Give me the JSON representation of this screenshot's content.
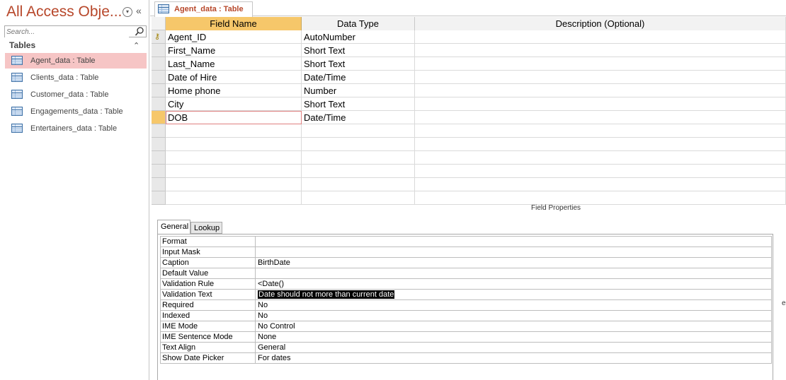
{
  "nav": {
    "title": "All Access Obje...",
    "search_placeholder": "Search...",
    "group_label": "Tables",
    "items": [
      {
        "label": "Agent_data : Table"
      },
      {
        "label": "Clients_data : Table"
      },
      {
        "label": "Customer_data : Table"
      },
      {
        "label": "Engagements_data : Table"
      },
      {
        "label": "Entertainers_data : Table"
      }
    ]
  },
  "tab": {
    "label": "Agent_data : Table"
  },
  "grid": {
    "headers": {
      "field_name": "Field Name",
      "data_type": "Data Type",
      "description": "Description (Optional)"
    },
    "rows": [
      {
        "field": "Agent_ID",
        "type": "AutoNumber",
        "primary_key": true
      },
      {
        "field": "First_Name",
        "type": "Short Text"
      },
      {
        "field": "Last_Name",
        "type": "Short Text"
      },
      {
        "field": "Date of Hire",
        "type": "Date/Time"
      },
      {
        "field": "Home phone",
        "type": "Number"
      },
      {
        "field": "City",
        "type": "Short Text"
      },
      {
        "field": "DOB",
        "type": "Date/Time",
        "current": true
      }
    ]
  },
  "field_properties": {
    "label": "Field Properties",
    "tabs": {
      "general": "General",
      "lookup": "Lookup"
    },
    "props": [
      {
        "name": "Format",
        "value": ""
      },
      {
        "name": "Input Mask",
        "value": ""
      },
      {
        "name": "Caption",
        "value": "BirthDate"
      },
      {
        "name": "Default Value",
        "value": ""
      },
      {
        "name": "Validation Rule",
        "value": "<Date()"
      },
      {
        "name": "Validation Text",
        "value": "Date should not more than current date"
      },
      {
        "name": "Required",
        "value": "No"
      },
      {
        "name": "Indexed",
        "value": "No"
      },
      {
        "name": "IME Mode",
        "value": "No Control"
      },
      {
        "name": "IME Sentence Mode",
        "value": "None"
      },
      {
        "name": "Text Align",
        "value": "General"
      },
      {
        "name": "Show Date Picker",
        "value": "For dates"
      }
    ],
    "edge_text": "e"
  },
  "colors": {
    "accent": "#b7472a",
    "header": "#f6c76a",
    "selected_nav": "#f6c5c5"
  }
}
